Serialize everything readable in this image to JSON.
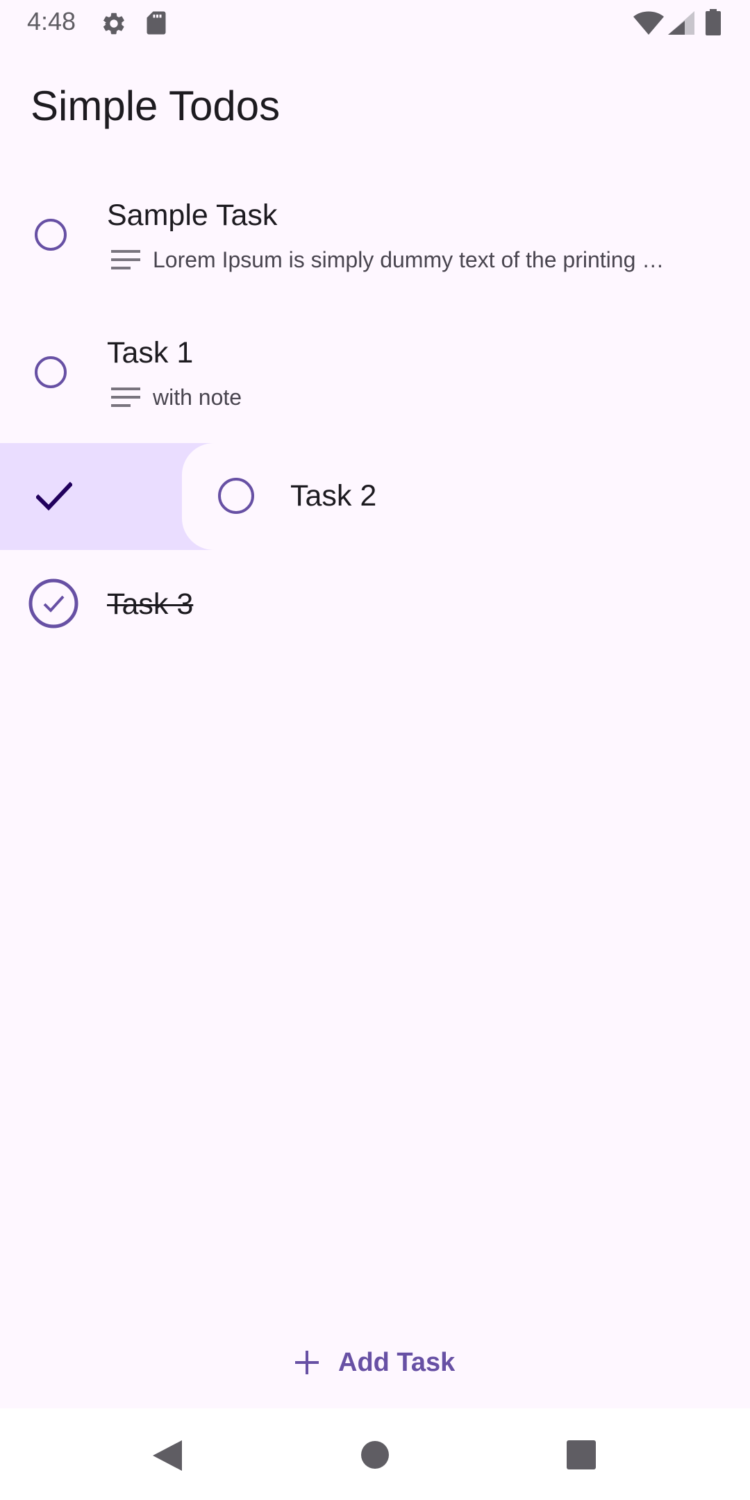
{
  "status_bar": {
    "time": "4:48",
    "left_icons": [
      "gear-icon",
      "sd-card-icon"
    ],
    "right_icons": [
      "wifi-icon",
      "signal-icon",
      "battery-icon"
    ]
  },
  "app": {
    "title": "Simple Todos"
  },
  "tasks": [
    {
      "title": "Sample Task",
      "note": "Lorem Ipsum is simply dummy text of the printing …",
      "completed": false
    },
    {
      "title": "Task 1",
      "note": "with note",
      "completed": false
    },
    {
      "title": "Task 2",
      "note": "",
      "completed": false,
      "swiping": true,
      "swipe_action_icon": "checkmark-icon"
    },
    {
      "title": "Task 3",
      "note": "",
      "completed": true
    }
  ],
  "actions": {
    "add_task_label": "Add Task",
    "add_task_icon": "plus-icon"
  },
  "nav_bar": {
    "buttons": [
      "back-icon",
      "home-icon",
      "recents-icon"
    ]
  },
  "colors": {
    "background": "#fef7ff",
    "accent": "#6750a4",
    "swipe_background": "#eaddff",
    "text_primary": "#1d1b20",
    "text_secondary": "#49454f"
  }
}
